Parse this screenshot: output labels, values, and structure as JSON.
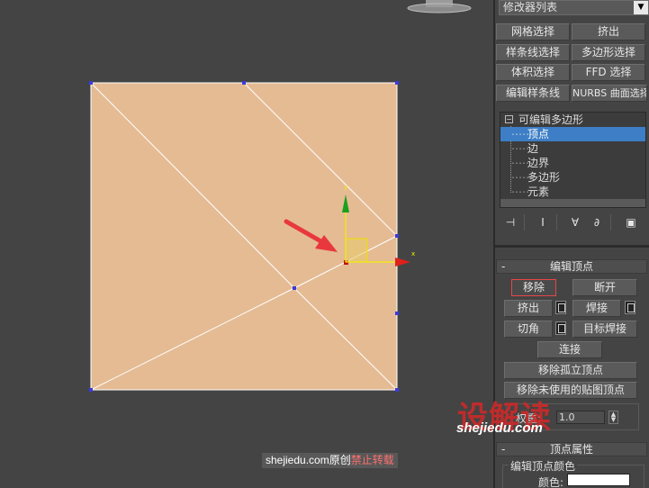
{
  "modifier_list": {
    "label": "修改器列表"
  },
  "modifier_buttons": [
    "网格选择",
    "挤出",
    "样条线选择",
    "多边形选择",
    "体积选择",
    "FFD 选择",
    "编辑样条线",
    "NURBS 曲面选择"
  ],
  "stack": {
    "root": "可编辑多边形",
    "items": [
      "顶点",
      "边",
      "边界",
      "多边形",
      "元素"
    ],
    "selected_index": 0
  },
  "edit_vertices": {
    "title": "编辑顶点",
    "collapse": "-",
    "remove": "移除",
    "break": "断开",
    "extrude": "挤出",
    "weld": "焊接",
    "chamfer": "切角",
    "target_weld": "目标焊接",
    "connect": "连接",
    "remove_isolated": "移除孤立顶点",
    "remove_unused_map": "移除未使用的贴图顶点",
    "weight_label": "权重:",
    "weight_value": "1.0"
  },
  "vertex_properties": {
    "title": "顶点属性",
    "collapse": "-",
    "edit_color_group": "编辑顶点颜色",
    "color_label": "颜色:"
  },
  "gizmo": {
    "x_label": "x",
    "y_label": "y"
  },
  "caption": {
    "site": "shejiedu.com原创",
    "notice": "禁止转载"
  },
  "watermark": {
    "logo": "设解读",
    "url": "shejiedu.com"
  },
  "colors": {
    "plane": "#e5bb94",
    "selection_blue": "#3d7ec6",
    "gizmo_x": "#e0201b",
    "gizmo_y": "#19a01e",
    "gizmo_plane": "#e8c96b",
    "arrow": "#e8383d"
  }
}
